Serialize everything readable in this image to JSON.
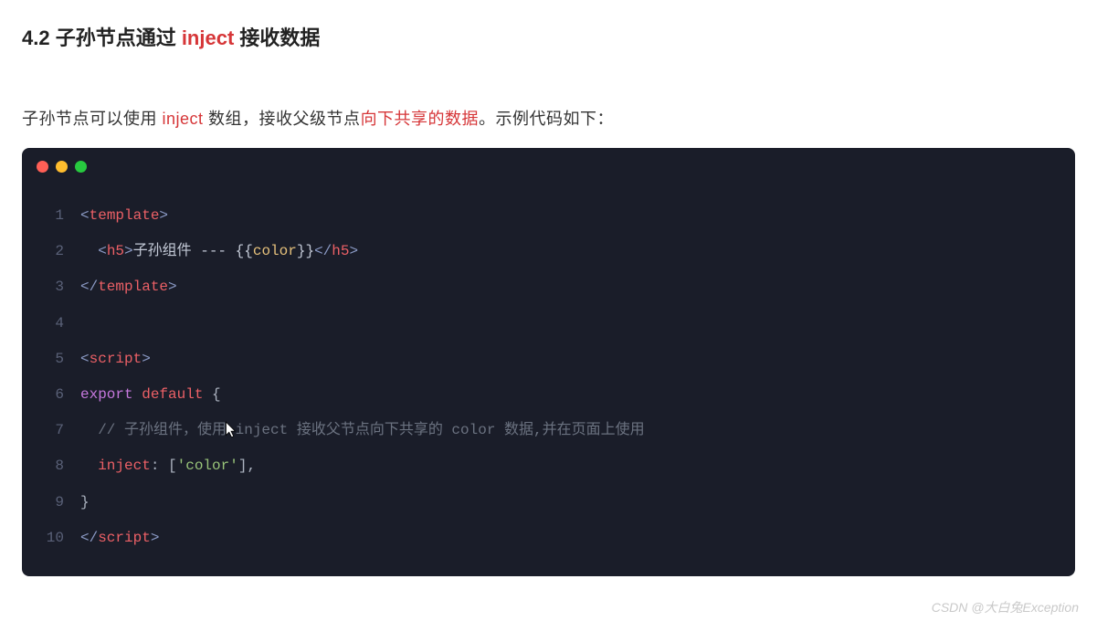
{
  "heading": {
    "prefix": "4.2 子孙节点通过 ",
    "highlight": "inject",
    "suffix": " 接收数据"
  },
  "description": {
    "part1": "子孙节点可以使用 ",
    "part2": "inject",
    "part3": " 数组，接收父级节点",
    "part4": "向下共享的数据",
    "part5": "。示例代码如下："
  },
  "code": {
    "lines": [
      {
        "num": "1"
      },
      {
        "num": "2"
      },
      {
        "num": "3"
      },
      {
        "num": "4"
      },
      {
        "num": "5"
      },
      {
        "num": "6"
      },
      {
        "num": "7"
      },
      {
        "num": "8"
      },
      {
        "num": "9"
      },
      {
        "num": "10"
      }
    ],
    "tokens": {
      "template_open_lt": "<",
      "template_tag": "template",
      "template_open_gt": ">",
      "h5_open_lt": "<",
      "h5_tag": "h5",
      "h5_open_gt": ">",
      "h5_text1": "子孙组件 --- {{",
      "h5_var": "color",
      "h5_text2": "}}",
      "h5_close_lt": "</",
      "h5_close_gt": ">",
      "template_close_lt": "</",
      "template_close_gt": ">",
      "script_open_lt": "<",
      "script_tag": "script",
      "script_open_gt": ">",
      "export_kw": "export",
      "default_kw": "default",
      "brace_open": " {",
      "comment_text": "// 子孙组件，使用 inject 接收父节点向下共享的 color 数据,并在页面上使用",
      "inject_prop": "inject",
      "colon": ": [",
      "string_val": "'color'",
      "array_close": "],",
      "brace_close": "}",
      "script_close_lt": "</",
      "script_close_gt": ">"
    }
  },
  "watermark": "CSDN @大白兔Exception"
}
